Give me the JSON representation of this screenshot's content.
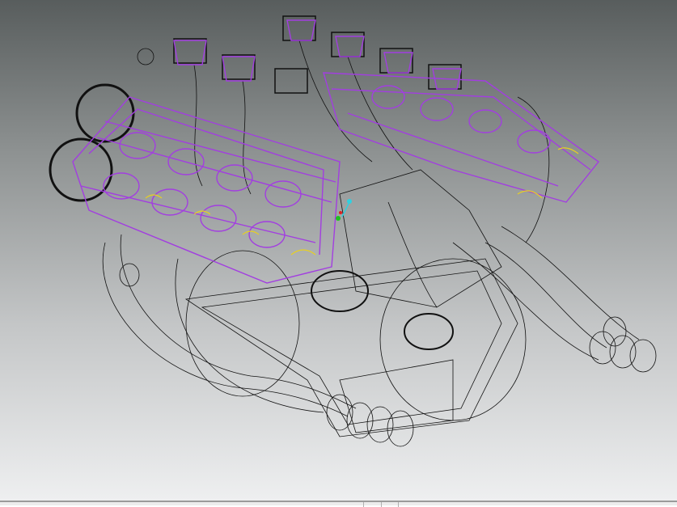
{
  "viewport": {
    "background_top": "#585d5d",
    "background_bottom": "#eeeff0",
    "wire_color": "#111111",
    "highlight_color": "#a23ee0",
    "accent_color": "#e8d020",
    "triad": {
      "x_color": "#e02020",
      "y_color": "#20c020",
      "z_color": "#30d0e0"
    }
  },
  "statusbar": {
    "segments": 3
  }
}
